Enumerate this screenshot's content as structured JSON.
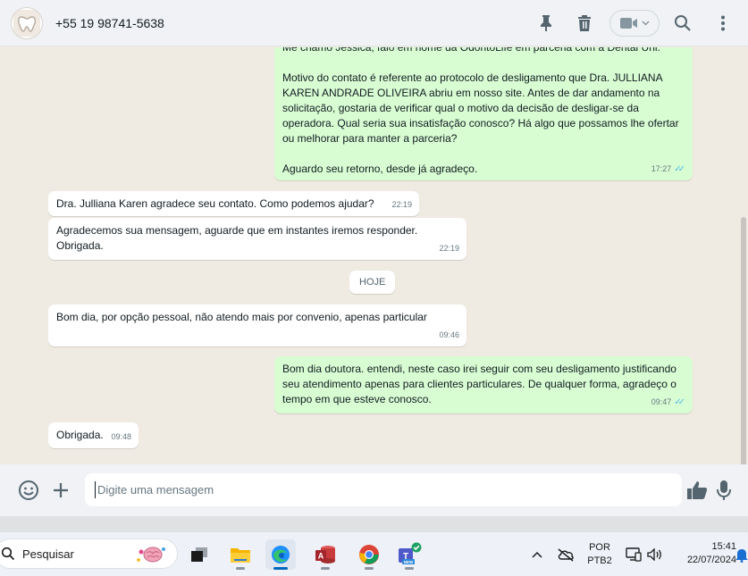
{
  "header": {
    "contact_name": "+55 19 98741-5638",
    "icons": [
      "pin-icon",
      "delete-icon",
      "video-call-icon",
      "search-icon",
      "menu-icon"
    ]
  },
  "messages": [
    {
      "direction": "out",
      "text": "Me chamo Jessica, falo em nome da OdontoLife em parceria com a Dental Uni.\n\nMotivo do contato é referente ao protocolo de desligamento que Dra. JULLIANA KAREN ANDRADE OLIVEIRA abriu em nosso site. Antes de dar andamento na solicitação, gostaria de verificar qual o motivo da decisão de desligar-se da operadora. Qual seria sua insatisfação conosco? Há algo que possamos lhe ofertar ou melhorar para manter a parceria?\n\nAguardo seu retorno, desde já agradeço.",
      "time": "17:27",
      "read": true
    },
    {
      "direction": "in",
      "text": "Dra. Julliana Karen agradece seu contato. Como podemos ajudar?",
      "time": "22:19"
    },
    {
      "direction": "in",
      "text": "Agradecemos sua mensagem, aguarde que em instantes iremos responder. Obrigada.",
      "time": "22:19"
    },
    {
      "direction": "in",
      "text": "Bom dia, por opção pessoal, não atendo mais por convenio, apenas particular",
      "time": "09:46"
    },
    {
      "direction": "out",
      "text": "Bom dia doutora. entendi, neste caso irei seguir com seu desligamento justificando seu atendimento apenas para clientes particulares. De qualquer forma, agradeço o tempo em que esteve conosco.",
      "time": "09:47",
      "read": true
    },
    {
      "direction": "in",
      "text": "Obrigada.",
      "time": "09:48"
    }
  ],
  "day_divider": "HOJE",
  "composer": {
    "placeholder": "Digite uma mensagem"
  },
  "taskbar": {
    "search_label": "Pesquisar",
    "language_line1": "POR",
    "language_line2": "PTB2",
    "time": "15:41",
    "date": "22/07/2024"
  },
  "colors": {
    "outgoing_bubble": "#d9fdd3",
    "incoming_bubble": "#ffffff",
    "read_ticks": "#53bdeb",
    "chat_background": "#efeae2"
  }
}
